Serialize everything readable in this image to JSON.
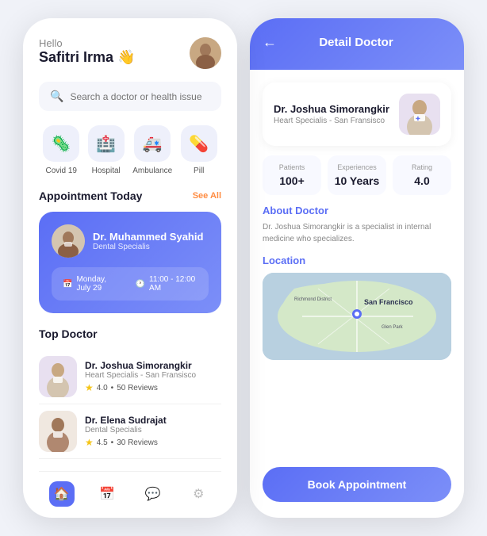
{
  "left_phone": {
    "greeting": {
      "hello": "Hello",
      "name": "Safitri Irma 👋"
    },
    "search": {
      "placeholder": "Search a doctor or health issue"
    },
    "categories": [
      {
        "id": "covid19",
        "icon": "🦠",
        "label": "Covid 19"
      },
      {
        "id": "hospital",
        "icon": "🏥",
        "label": "Hospital"
      },
      {
        "id": "ambulance",
        "icon": "🚑",
        "label": "Ambulance"
      },
      {
        "id": "pill",
        "icon": "💊",
        "label": "Pill"
      }
    ],
    "appointment_section": {
      "title": "Appointment Today",
      "see_all": "See All",
      "card": {
        "doctor_name": "Dr. Muhammed Syahid",
        "speciality": "Dental Specialis",
        "date": "Monday, July 29",
        "time": "11:00 - 12:00 AM"
      }
    },
    "top_doctor_section": {
      "title": "Top Doctor",
      "doctors": [
        {
          "name": "Dr. Joshua Simorangkir",
          "speciality": "Heart Specialis - San Fransisco",
          "rating": "4.0",
          "reviews": "50 Reviews"
        },
        {
          "name": "Dr. Elena Sudrajat",
          "speciality": "Dental Specialis",
          "rating": "4.5",
          "reviews": "30 Reviews"
        }
      ]
    },
    "bottom_nav": [
      {
        "id": "home",
        "icon": "⌂",
        "active": true
      },
      {
        "id": "calendar",
        "icon": "📅",
        "active": false
      },
      {
        "id": "chat",
        "icon": "💬",
        "active": false
      },
      {
        "id": "settings",
        "icon": "⚙",
        "active": false
      }
    ]
  },
  "right_phone": {
    "header": {
      "title": "Detail Doctor",
      "back_label": "←"
    },
    "doctor": {
      "name": "Dr. Joshua Simorangkir",
      "speciality": "Heart Specialis - San Fransisco"
    },
    "stats": [
      {
        "label": "Patients",
        "value": "100+"
      },
      {
        "label": "Experiences",
        "value": "10 Years"
      },
      {
        "label": "Rating",
        "value": "4.0"
      }
    ],
    "about": {
      "title": "About Doctor",
      "text": "Dr. Joshua Simorangkir is a specialist in internal medicine who specializes."
    },
    "location": {
      "title": "Location",
      "city": "San Francisco"
    },
    "book_button": "Book Appointment"
  }
}
